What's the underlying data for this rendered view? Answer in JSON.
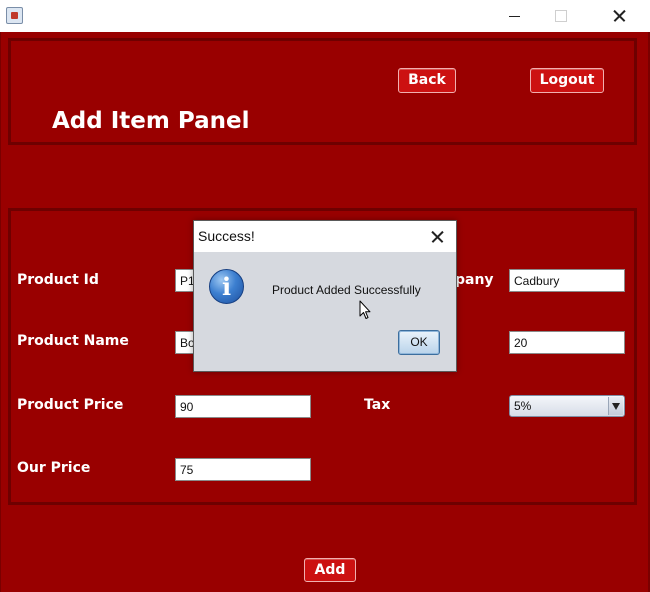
{
  "window": {
    "title": "",
    "controls": {
      "minimize": "minimize",
      "maximize": "maximize",
      "close": "close"
    }
  },
  "header": {
    "title": "Add Item Panel",
    "back_label": "Back",
    "logout_label": "Logout"
  },
  "form": {
    "product_id": {
      "label": "Product Id",
      "value": "P1"
    },
    "product_name": {
      "label": "Product Name",
      "value": "Bo"
    },
    "product_price": {
      "label": "Product Price",
      "value": "90"
    },
    "our_price": {
      "label": "Our Price",
      "value": "75"
    },
    "company": {
      "label_visible": "pany",
      "value": "Cadbury"
    },
    "quantity": {
      "value": "20"
    },
    "tax": {
      "label": "Tax",
      "selected": "5%"
    }
  },
  "add_label": "Add",
  "dialog": {
    "title": "Success!",
    "message": "Product Added Successfully",
    "ok_label": "OK",
    "icon": "information-icon",
    "icon_glyph": "i"
  },
  "colors": {
    "background": "#990000",
    "panel_border": "#6e0000",
    "button": "#cc1111",
    "label_text": "#ffffff"
  }
}
